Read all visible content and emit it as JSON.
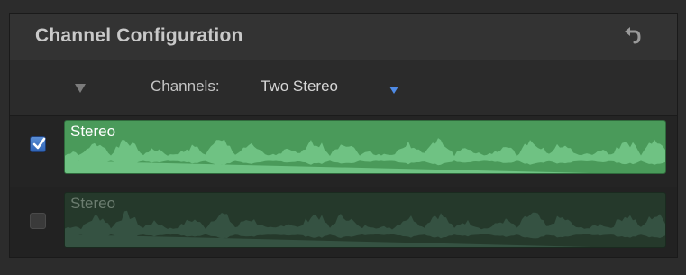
{
  "panel": {
    "title": "Channel Configuration"
  },
  "toolbar": {
    "reset_icon": "undo-arrow-icon"
  },
  "config": {
    "channels_label": "Channels:",
    "channels_value": "Two Stereo",
    "disclosure_icon": "triangle-down-icon",
    "popup_icon": "chevron-down-icon"
  },
  "channels": [
    {
      "label": "Stereo",
      "enabled": true
    },
    {
      "label": "Stereo",
      "enabled": false
    }
  ],
  "colors": {
    "accent": "#3d7ee0",
    "waveform_active": "#4a9a5a",
    "waveform_inactive": "#25392b"
  }
}
